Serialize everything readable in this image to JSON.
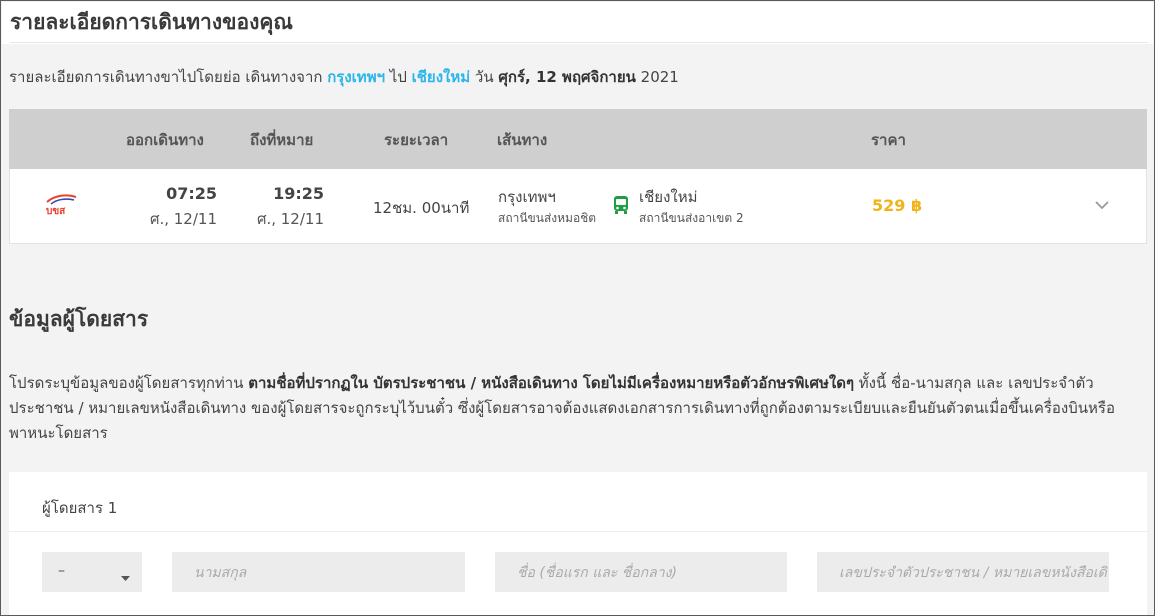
{
  "trip": {
    "heading": "รายละเอียดการเดินทางของคุณ",
    "summary_prefix": "รายละเอียดการเดินทางขาไปโดยย่อ เดินทางจาก ",
    "from_city": "กรุงเทพฯ",
    "connector": " ไป ",
    "to_city": "เชียงใหม่",
    "day_word": " วัน ",
    "date_text": "ศุกร์, 12 พฤศจิกายน",
    "year": " 2021"
  },
  "table": {
    "headers": {
      "depart": "ออกเดินทาง",
      "arrive": "ถึงที่หมาย",
      "duration": "ระยะเวลา",
      "route": "เส้นทาง",
      "price": "ราคา"
    },
    "row": {
      "operator_logo_text": "บขส",
      "depart_time": "07:25",
      "depart_date": "ศ., 12/11",
      "arrive_time": "19:25",
      "arrive_date": "ศ., 12/11",
      "duration": "12ชม. 00นาที",
      "origin_city": "กรุงเทพฯ",
      "origin_station": "สถานีขนส่งหมอชิต",
      "dest_city": "เชียงใหม่",
      "dest_station": "สถานีขนส่งอาเขต 2",
      "price": "529 ฿"
    }
  },
  "passenger_info": {
    "heading": "ข้อมูลผู้โดยสาร",
    "para_1": "โปรดระบุข้อมูลของผู้โดยสารทุกท่าน ",
    "para_bold": "ตามชื่อที่ปรากฏใน บัตรประชาชน / หนังสือเดินทาง โดยไม่มีเครื่องหมายหรือตัวอักษรพิเศษใดๆ",
    "para_2": " ทั้งนี้ ชื่อ-นามสกุล และ เลขประจำตัวประชาชน / หมายเลขหนังสือเดินทาง ของผู้โดยสารจะถูกระบุไว้บนตั๋ว ซึ่งผู้โดยสารอาจต้องแสดงเอกสารการเดินทางที่ถูกต้องตามระเบียบและยืนยันตัวตนเมื่อขึ้นเครื่องบินหรือพาหนะโดยสาร"
  },
  "passenger_form": {
    "title": "ผู้โดยสาร 1",
    "title_select_value": "–",
    "surname_placeholder": "นามสกุล",
    "firstname_placeholder": "ชื่อ (ชื่อแรก และ ชื่อกลาง)",
    "id_placeholder": "เลขประจำตัวประชาชน / หมายเลขหนังสือเดินทาง"
  },
  "colors": {
    "accent_city": "#2ab6e8",
    "price": "#f2b21a",
    "bus_icon": "#1f9e45",
    "logo": "#e8412c"
  },
  "icons": {
    "operator": "operator-logo-icon",
    "bus": "bus-icon",
    "expand": "chevron-down-icon",
    "select_caret": "caret-down-icon"
  }
}
